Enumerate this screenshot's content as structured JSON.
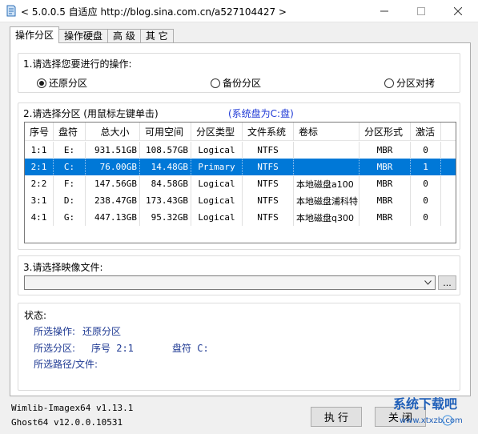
{
  "window": {
    "title": "< 5.0.0.5 自适应 http://blog.sina.com.cn/a527104427 >"
  },
  "tabs": [
    "操作分区",
    "操作硬盘",
    "高 级",
    "其 它"
  ],
  "operation": {
    "title": "1.请选择您要进行的操作:",
    "options": [
      "还原分区",
      "备份分区",
      "分区对拷"
    ],
    "selected_index": 0
  },
  "partition": {
    "title": "2.请选择分区 (用鼠标左键单击)",
    "system_note": "(系统盘为C:盘)",
    "columns": [
      "序号",
      "盘符",
      "总大小",
      "可用空间",
      "分区类型",
      "文件系统",
      "卷标",
      "分区形式",
      "激活"
    ],
    "rows": [
      {
        "num": "1:1",
        "drive": "E:",
        "total": "931.51GB",
        "free": "108.57GB",
        "type": "Logical",
        "fs": "NTFS",
        "label": "",
        "style": "MBR",
        "active": "0",
        "selected": false
      },
      {
        "num": "2:1",
        "drive": "C:",
        "total": "76.00GB",
        "free": "14.48GB",
        "type": "Primary",
        "fs": "NTFS",
        "label": "",
        "style": "MBR",
        "active": "1",
        "selected": true
      },
      {
        "num": "2:2",
        "drive": "F:",
        "total": "147.56GB",
        "free": "84.58GB",
        "type": "Logical",
        "fs": "NTFS",
        "label": "本地磁盘a100",
        "style": "MBR",
        "active": "0",
        "selected": false
      },
      {
        "num": "3:1",
        "drive": "D:",
        "total": "238.47GB",
        "free": "173.43GB",
        "type": "Logical",
        "fs": "NTFS",
        "label": "本地磁盘浦科特",
        "style": "MBR",
        "active": "0",
        "selected": false
      },
      {
        "num": "4:1",
        "drive": "G:",
        "total": "447.13GB",
        "free": "95.32GB",
        "type": "Logical",
        "fs": "NTFS",
        "label": "本地磁盘q300",
        "style": "MBR",
        "active": "0",
        "selected": false
      }
    ]
  },
  "image_file": {
    "title": "3.请选择映像文件:",
    "value": "",
    "browse_label": "..."
  },
  "status": {
    "title": "状态:",
    "op_label": "所选操作:",
    "op_value": "还原分区",
    "part_label": "所选分区:",
    "part_num": "序号 2:1",
    "part_drive": "盘符 C:",
    "path_label": "所选路径/文件:",
    "path_value": ""
  },
  "versions": {
    "wimlib": "Wimlib-Imagex64 v1.13.1",
    "ghost": "Ghost64 v12.0.0.10531"
  },
  "buttons": {
    "execute": "执 行",
    "close": "关 闭"
  },
  "watermark": {
    "text": "系统下载吧",
    "url": "www.xtxzb.com"
  },
  "colors": {
    "selection": "#0078d7",
    "note_blue": "#1f3a93"
  }
}
